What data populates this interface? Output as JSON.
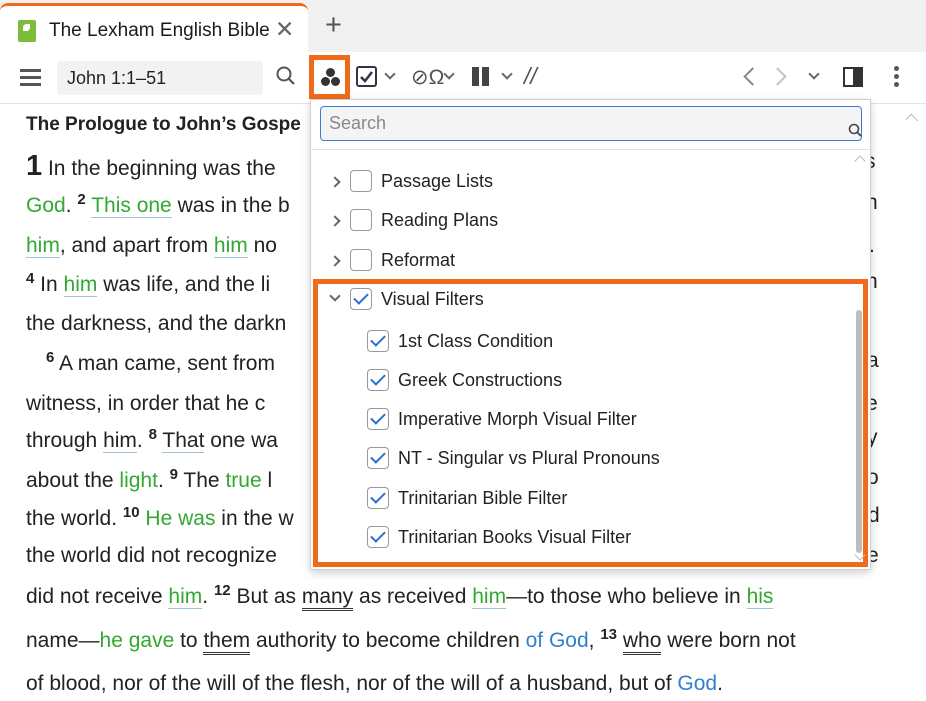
{
  "tab": {
    "title": "The Lexham English Bible",
    "close": "✕",
    "add": "+"
  },
  "toolbar": {
    "reference": "John 1:1–51",
    "parallel": "//"
  },
  "text": {
    "heading": "The Prologue to John’s Gospe",
    "l1a": "1",
    "l1b": " In the beginning was the",
    "l1c": "s",
    "l2a": "God",
    "l2b": ". ",
    "l2c": "2",
    "l2d": " ",
    "l2e": "This one",
    "l2f": " was in the b",
    "l2g": "h",
    "l3a": "him",
    "l3b": ", and apart from ",
    "l3c": "him",
    "l3d": " no",
    "l3e": ".",
    "l4a": "4",
    "l4b": " In ",
    "l4c": "him",
    "l4d": " was life, and the li",
    "l4e": "n",
    "l5a": "the darkness, and the darkn",
    "l6a": "6",
    "l6b": " A man came, sent from",
    "l6c": "a",
    "l7a": "witness, in order that he c",
    "l7b": "e",
    "l8a": "through ",
    "l8b": "him",
    "l8c": ". ",
    "l8d": "8",
    "l8e": " ",
    "l8f": "That",
    "l8g": " one wa",
    "l8h": "y",
    "l9a": "about the ",
    "l9b": "light",
    "l9c": ". ",
    "l9d": "9",
    "l9e": " The ",
    "l9f": "true",
    "l9g": " l",
    "l9h": "o",
    "l10a": "the world. ",
    "l10b": "10",
    "l10c": " ",
    "l10d": "He was",
    "l10e": " in the w",
    "l10f": "d",
    "l11a": "the world did not recognize",
    "l11b": "e",
    "l12a": "did not receive ",
    "l12b": "him",
    "l12c": ". ",
    "l12d": "12",
    "l12e": " But as ",
    "l12f": "many",
    "l12g": " as received ",
    "l12h": "him",
    "l12i": "—to those who believe in ",
    "l12j": "his",
    "l13a": "name—",
    "l13b": "he gave",
    "l13c": " to ",
    "l13d": "them",
    "l13e": " authority to become children ",
    "l13f": "of God",
    "l13g": ", ",
    "l13h": "13",
    "l13i": " ",
    "l13j": "who",
    "l13k": " were born not",
    "l14a": "of blood, nor of the will of the flesh, nor of the will of a husband, but of ",
    "l14b": "God",
    "l14c": "."
  },
  "popup": {
    "search_placeholder": "Search",
    "items": [
      {
        "label": "Passage Lists",
        "checked": false
      },
      {
        "label": "Reading Plans",
        "checked": false
      },
      {
        "label": "Reformat",
        "checked": false
      },
      {
        "label": "Visual Filters",
        "checked": true
      }
    ],
    "subitems": [
      {
        "label": "1st Class Condition",
        "checked": true
      },
      {
        "label": "Greek Constructions",
        "checked": true
      },
      {
        "label": "Imperative Morph Visual Filter",
        "checked": true
      },
      {
        "label": "NT - Singular vs Plural Pronouns",
        "checked": true
      },
      {
        "label": "Trinitarian Bible Filter",
        "checked": true
      },
      {
        "label": "Trinitarian Books Visual Filter",
        "checked": true
      }
    ]
  },
  "colors": {
    "highlight": "#ef6a1a",
    "green_text": "#32a832",
    "blue_text": "#3080d0",
    "check": "#2a6fd0"
  }
}
